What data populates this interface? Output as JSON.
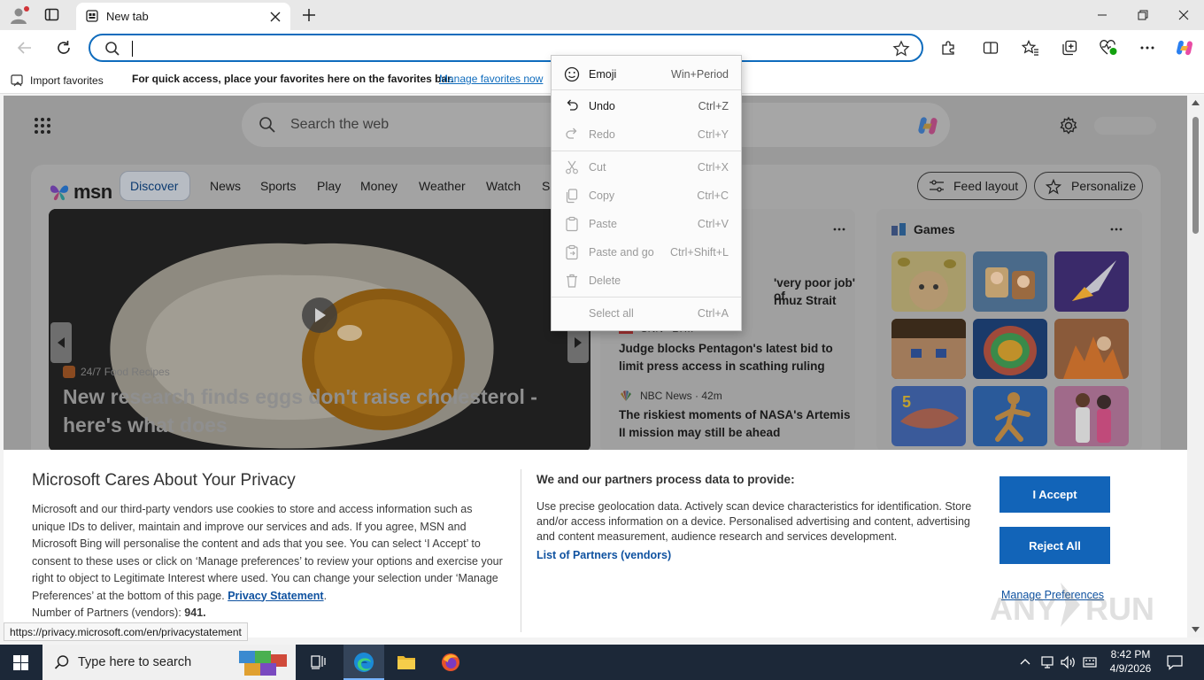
{
  "browser": {
    "tab_title": "New tab",
    "favorites_bar": {
      "import_label": "Import favorites",
      "message": "For quick access, place your favorites here on the favorites bar.",
      "manage_link": "Manage favorites now"
    }
  },
  "msn": {
    "search_placeholder": "Search the web",
    "logo_text": "msn",
    "nav": [
      "Discover",
      "News",
      "Sports",
      "Play",
      "Money",
      "Weather",
      "Watch",
      "Sh"
    ],
    "feed_layout_label": "Feed layout",
    "personalize_label": "Personalize",
    "hero": {
      "source": "24/7 Food Recipes",
      "headline": "New research finds eggs don't raise cholesterol - here's what does"
    },
    "news": [
      {
        "source": "",
        "headline": "'very poor job' of ... rmuz Strait"
      },
      {
        "source": "CNN · 27m",
        "headline": "Judge blocks Pentagon's latest bid to limit press access in scathing ruling"
      },
      {
        "source": "NBC News · 42m",
        "headline": "The riskiest moments of NASA's Artemis II mission may still be ahead"
      }
    ],
    "news_fragment_1": "'very poor job' of",
    "news_fragment_2": "rmuz Strait",
    "games_title": "Games"
  },
  "context_menu": {
    "items": [
      {
        "label": "Emoji",
        "shortcut": "Win+Period",
        "enabled": true
      },
      {
        "label": "Undo",
        "shortcut": "Ctrl+Z",
        "enabled": true
      },
      {
        "label": "Redo",
        "shortcut": "Ctrl+Y",
        "enabled": false
      },
      {
        "label": "Cut",
        "shortcut": "Ctrl+X",
        "enabled": false
      },
      {
        "label": "Copy",
        "shortcut": "Ctrl+C",
        "enabled": false
      },
      {
        "label": "Paste",
        "shortcut": "Ctrl+V",
        "enabled": false
      },
      {
        "label": "Paste and go",
        "shortcut": "Ctrl+Shift+L",
        "enabled": false
      },
      {
        "label": "Delete",
        "shortcut": "",
        "enabled": false
      },
      {
        "label": "Select all",
        "shortcut": "Ctrl+A",
        "enabled": false
      }
    ]
  },
  "privacy": {
    "title": "Microsoft Cares About Your Privacy",
    "body": "Microsoft and our third-party vendors use cookies to store and access information such as unique IDs to deliver, maintain and improve our services and ads. If you agree, MSN and Microsoft Bing will personalise the content and ads that you see. You can select ‘I Accept’ to consent to these uses or click on ‘Manage preferences’ to review your options and exercise your right to object to Legitimate Interest where used. You can change your selection under ‘Manage Preferences’ at the bottom of this page.",
    "privacy_link": "Privacy Statement",
    "partners_label": "Number of Partners (vendors):",
    "partners_count": "941",
    "right_title": "We and our partners process data to provide:",
    "right_body": "Use precise geolocation data. Actively scan device characteristics for identification. Store and/or access information on a device. Personalised advertising and content, advertising and content measurement, audience research and services development.",
    "partners_link": "List of Partners (vendors)",
    "accept_label": "I Accept",
    "reject_label": "Reject All",
    "manage_label": "Manage Preferences"
  },
  "status_url": "https://privacy.microsoft.com/en/privacystatement",
  "taskbar": {
    "search_placeholder": "Type here to search",
    "time": "8:42 PM",
    "date": "4/9/2026"
  },
  "watermark": "ANY.RUN",
  "colors": {
    "accent": "#0f6cbd",
    "button_blue": "#1264b8",
    "taskbar": "#1c2838"
  }
}
